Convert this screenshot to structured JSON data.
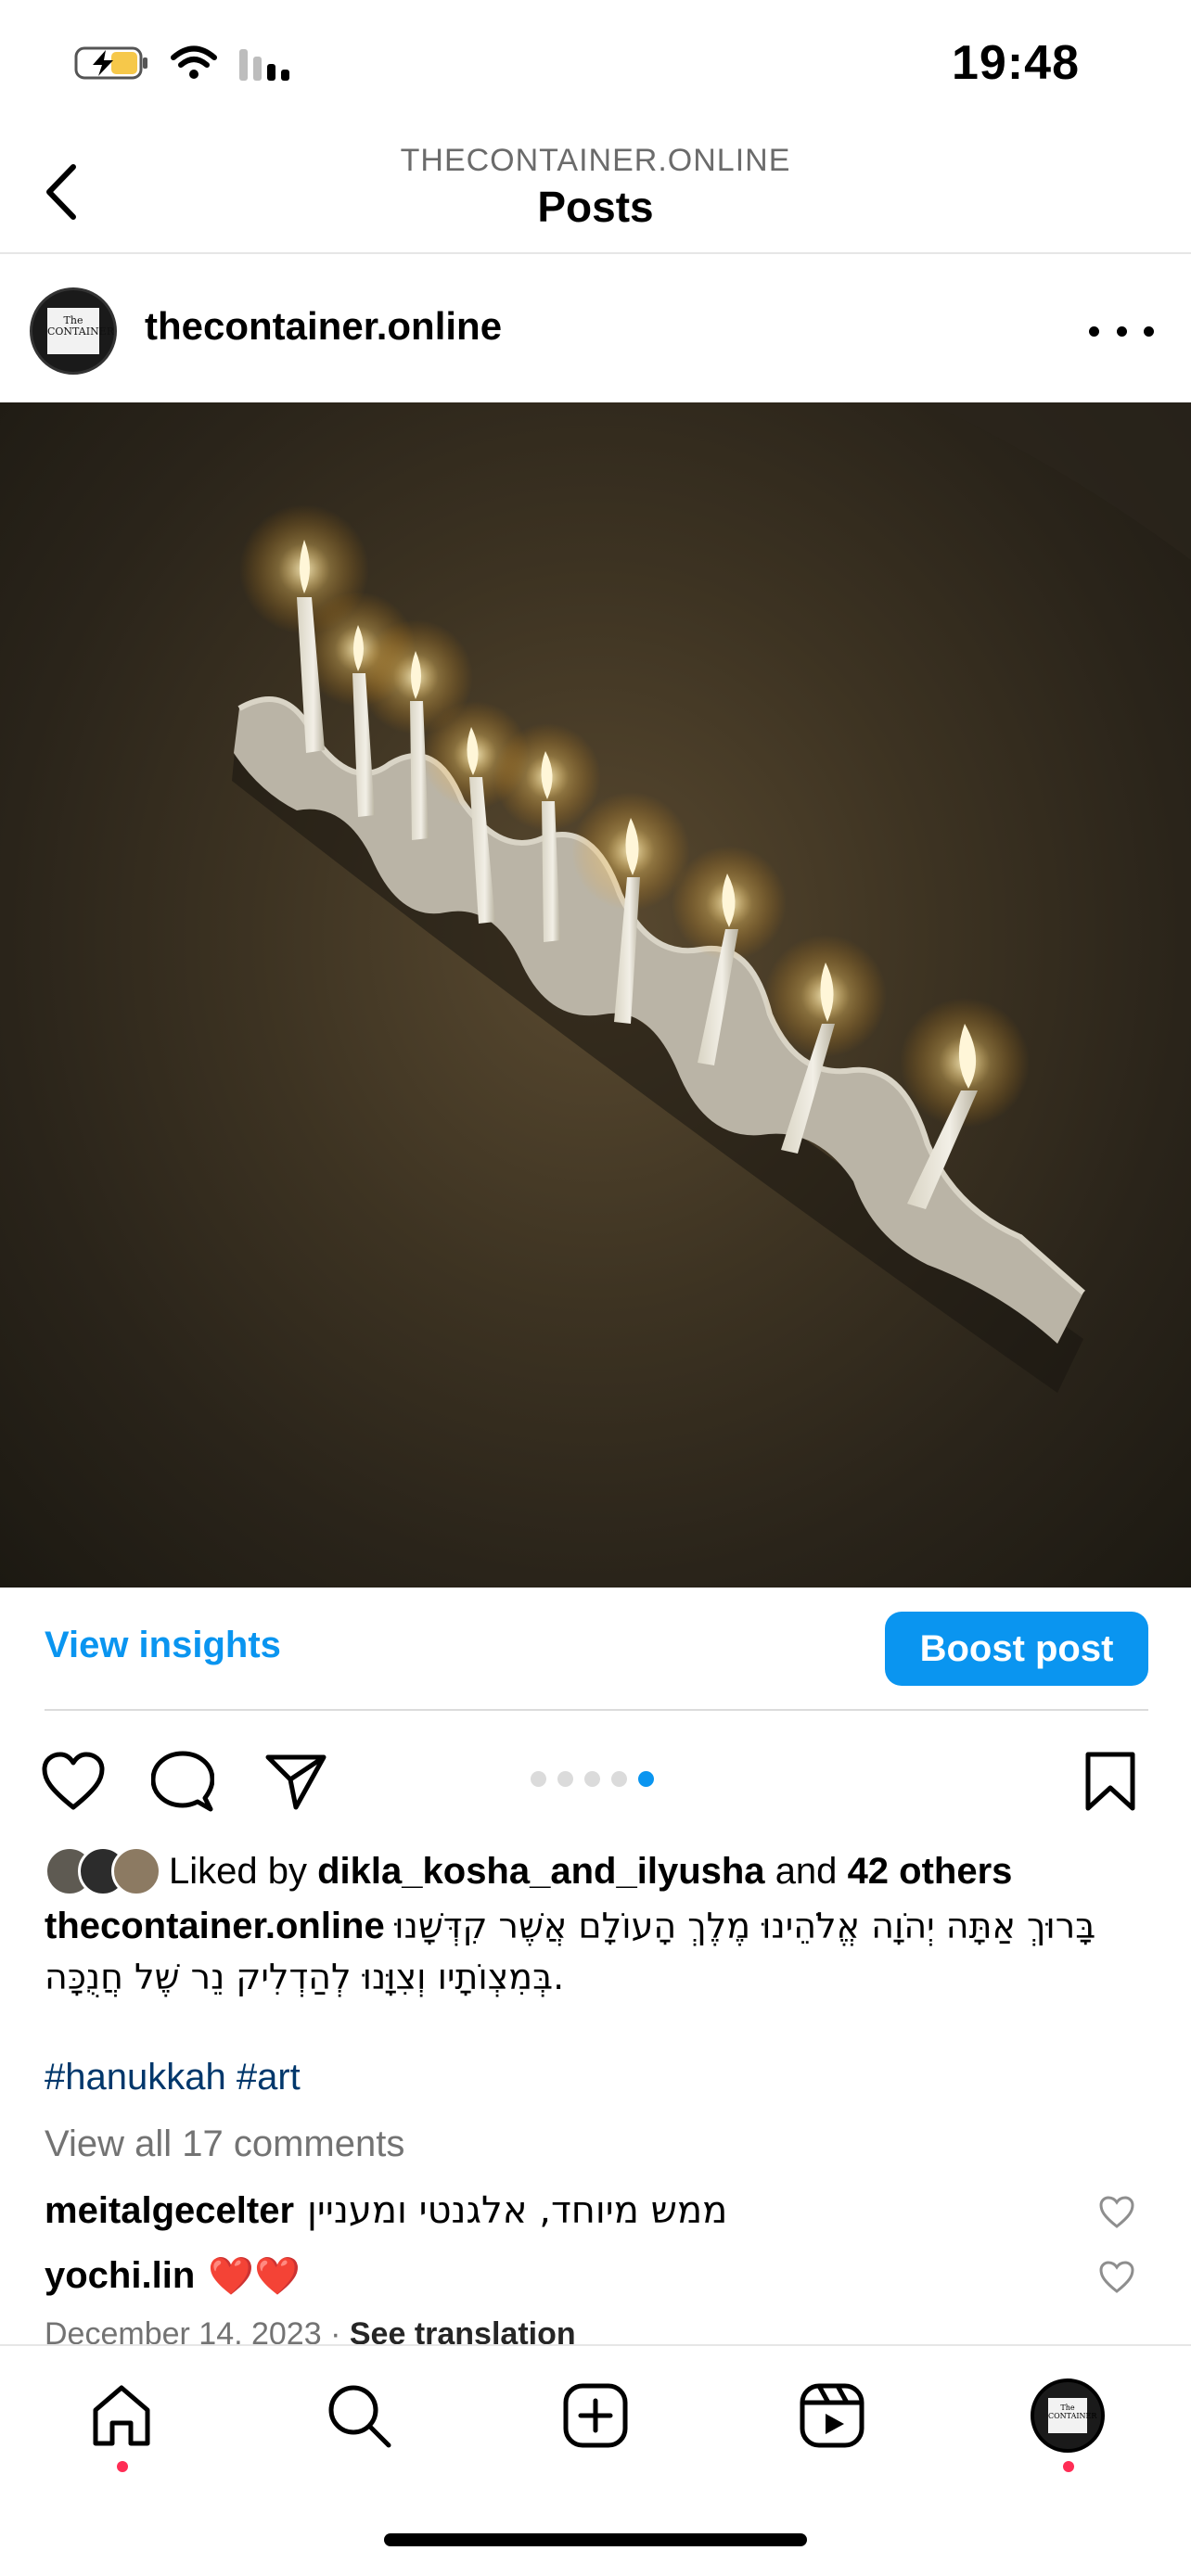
{
  "status_bar": {
    "time": "19:48",
    "battery_icon": "battery-charging-icon",
    "wifi_icon": "wifi-icon",
    "signal_icon": "cellular-signal-icon"
  },
  "header": {
    "subtitle": "THECONTAINER.ONLINE",
    "title": "Posts"
  },
  "post": {
    "author": "thecontainer.online",
    "avatar_text": "The CONTAINER",
    "view_insights_label": "View insights",
    "boost_label": "Boost post",
    "carousel": {
      "count": 5,
      "active_index": 4
    },
    "likes": {
      "prefix": "Liked by",
      "user": "dikla_kosha_and_ilyusha",
      "and": "and",
      "others": "42 others"
    },
    "caption": {
      "author": "thecontainer.online",
      "text": "בָּרוּךְ אַתָּה יְהֹוָה אֱלֹהֵינוּ מֶלֶךְ הָעוֹלָם אֲשֶׁר קִדְּשָׁנוּ בְּמִצְוֹתָיו וְצִוָּנוּ לְהַדְלִיק נֵר שֶׁל חֲנֻכָּה."
    },
    "hashtags": "#hanukkah #art",
    "view_comments": "View all 17 comments",
    "comments": [
      {
        "user": "meitalgecelter",
        "text": "ממש מיוחד, אלגנטי ומעניין"
      },
      {
        "user": "yochi.lin",
        "text": "❤️❤️"
      }
    ],
    "date": "December 14, 2023",
    "date_separator": "·",
    "see_translation": "See translation"
  },
  "colors": {
    "accent": "#0a95f0",
    "hashtag": "#00376b",
    "muted": "#737373",
    "notification_dot": "#ff2d55"
  },
  "nav": {
    "items": [
      "home-icon",
      "search-icon",
      "create-icon",
      "reels-icon",
      "profile-avatar"
    ]
  }
}
